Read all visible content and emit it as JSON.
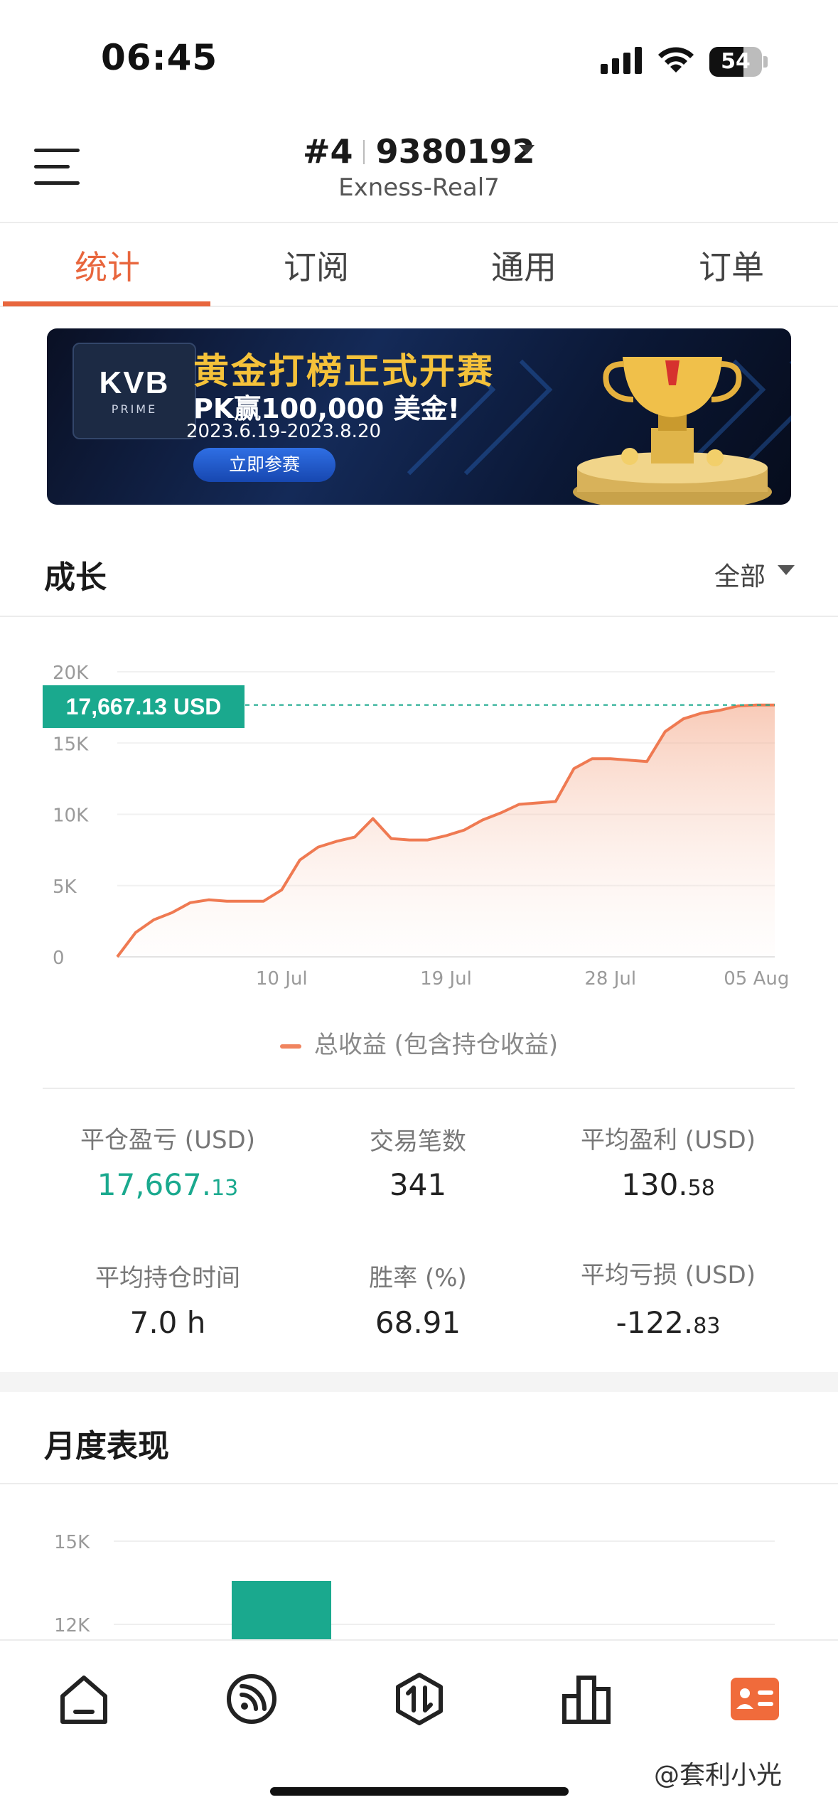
{
  "status_bar": {
    "time": "06:45",
    "battery": "54"
  },
  "header": {
    "account_number": "#4",
    "account_id": "9380192",
    "server": "Exness-Real7"
  },
  "tabs": [
    {
      "label": "统计",
      "active": true
    },
    {
      "label": "订阅",
      "active": false
    },
    {
      "label": "通用",
      "active": false
    },
    {
      "label": "订单",
      "active": false
    }
  ],
  "banner": {
    "logo_main": "KVB",
    "logo_sub": "PRIME",
    "title": "黄金打榜正式开赛",
    "subtitle": "PK赢100,000 美金!",
    "dates": "2023.6.19-2023.8.20",
    "button": "立即参赛"
  },
  "growth": {
    "title": "成长",
    "range_label": "全部",
    "current_value_tag": "17,667.13 USD",
    "legend": "总收益 (包含持仓收益)"
  },
  "chart_data": {
    "type": "area",
    "title": "",
    "xlabel": "",
    "ylabel": "",
    "ylim": [
      0,
      20000
    ],
    "y_ticks": [
      "20K",
      "15K",
      "10K",
      "5K",
      "0"
    ],
    "x_ticks": [
      "10 Jul",
      "19 Jul",
      "28 Jul",
      "05 Aug"
    ],
    "series": [
      {
        "name": "总收益 (包含持仓收益)",
        "x": [
          "2023-07-01",
          "2023-07-02",
          "2023-07-03",
          "2023-07-04",
          "2023-07-05",
          "2023-07-06",
          "2023-07-07",
          "2023-07-08",
          "2023-07-09",
          "2023-07-10",
          "2023-07-11",
          "2023-07-12",
          "2023-07-13",
          "2023-07-14",
          "2023-07-15",
          "2023-07-16",
          "2023-07-17",
          "2023-07-18",
          "2023-07-19",
          "2023-07-20",
          "2023-07-21",
          "2023-07-22",
          "2023-07-23",
          "2023-07-24",
          "2023-07-25",
          "2023-07-26",
          "2023-07-27",
          "2023-07-28",
          "2023-07-29",
          "2023-07-30",
          "2023-07-31",
          "2023-08-01",
          "2023-08-02",
          "2023-08-03",
          "2023-08-04",
          "2023-08-05",
          "2023-08-06"
        ],
        "values": [
          0,
          1700,
          2600,
          3100,
          3800,
          4000,
          3900,
          3900,
          3900,
          4700,
          6800,
          7700,
          8100,
          8400,
          9700,
          8300,
          8200,
          8200,
          8500,
          8900,
          9600,
          10100,
          10700,
          10800,
          10900,
          13200,
          13900,
          13900,
          13800,
          13700,
          15800,
          16700,
          17100,
          17300,
          17600,
          17667,
          17667
        ]
      }
    ],
    "grid": true,
    "fill": "gradient"
  },
  "stats": [
    {
      "label": "平仓盈亏 (USD)",
      "value_main": "17,667.",
      "value_dec": "13",
      "color": "#1aa98e"
    },
    {
      "label": "交易笔数",
      "value_main": "341",
      "value_dec": ""
    },
    {
      "label": "平均盈利 (USD)",
      "value_main": "130.",
      "value_dec": "58"
    },
    {
      "label": "平均持仓时间",
      "value_main": "7.0 h",
      "value_dec": ""
    },
    {
      "label": "胜率 (%)",
      "value_main": "68.91",
      "value_dec": ""
    },
    {
      "label": "平均亏损 (USD)",
      "value_main": "-122.",
      "value_dec": "83"
    }
  ],
  "monthly": {
    "title": "月度表现",
    "y_ticks": [
      "15K",
      "12K"
    ]
  },
  "bottom_nav": [
    {
      "icon": "home-icon"
    },
    {
      "icon": "signal-feed-icon"
    },
    {
      "icon": "trade-icon"
    },
    {
      "icon": "ranking-icon"
    },
    {
      "icon": "account-card-icon",
      "active": true
    }
  ],
  "watermark": "@套利小光",
  "colors": {
    "accent": "#e8663d",
    "positive": "#1aa98e",
    "bar": "#1aa98e"
  }
}
